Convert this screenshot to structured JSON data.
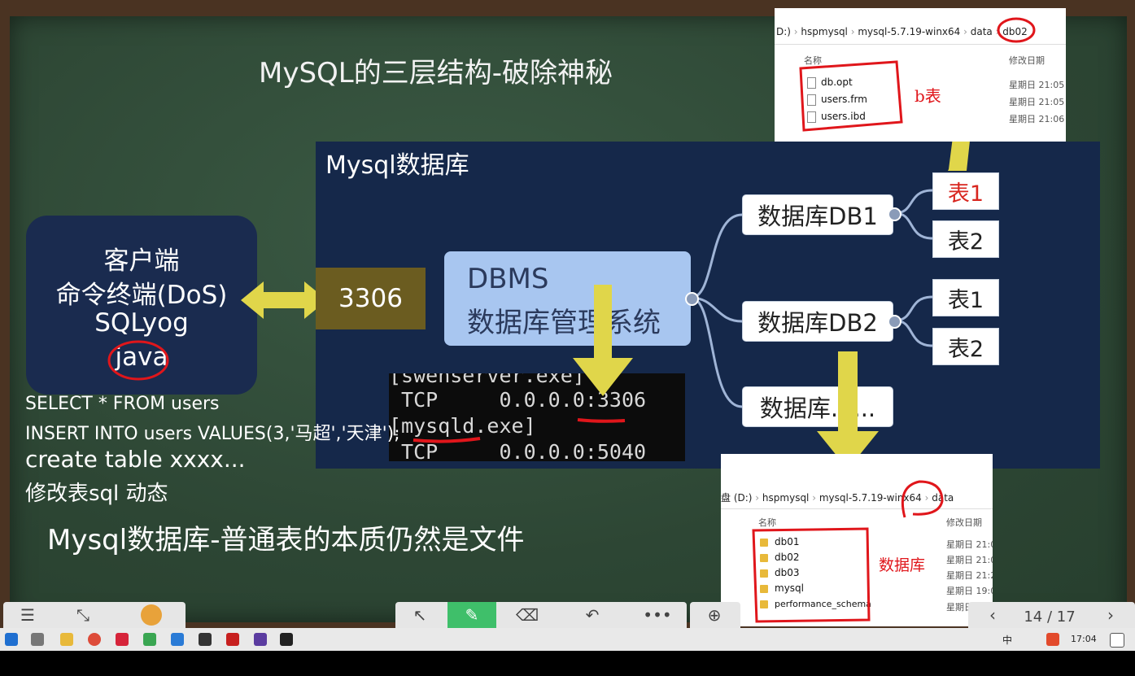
{
  "slide": {
    "title": "MySQL的三层结构-破除神秘",
    "db_panel_title": "Mysql数据库",
    "client": {
      "lines": [
        "客户端",
        "命令终端(DoS)",
        "SQLyog",
        "java"
      ]
    },
    "port": "3306",
    "dbms": {
      "line1": "DBMS",
      "line2": "数据库管理系统"
    },
    "databases": [
      {
        "label": "数据库DB1",
        "tables": [
          "表1",
          "表2"
        ]
      },
      {
        "label": "数据库DB2",
        "tables": [
          "表1",
          "表2"
        ]
      },
      {
        "label": "数据库......"
      }
    ],
    "cmd_lines": [
      "[swenserver.exe]",
      " TCP     0.0.0.0:3306",
      "[mysqld.exe]",
      " TCP     0.0.0.0:5040"
    ],
    "sql_lines": [
      "SELECT * FROM users",
      "INSERT INTO users VALUES(3,'马超','天津');",
      "create table xxxx...",
      "修改表sql 动态"
    ],
    "footer": "Mysql数据库-普通表的本质仍然是文件"
  },
  "explorer_top": {
    "breadcrumb": [
      "D:)",
      "hspmysql",
      "mysql-5.7.19-winx64",
      "data",
      "db02"
    ],
    "col_name": "名称",
    "col_date": "修改日期",
    "files": [
      {
        "name": "db.opt",
        "date": "星期日 21:05"
      },
      {
        "name": "users.frm",
        "date": "星期日 21:05"
      },
      {
        "name": "users.ibd",
        "date": "星期日 21:06"
      }
    ],
    "annotation": "b表"
  },
  "explorer_bottom": {
    "breadcrumb": [
      "盘 (D:)",
      "hspmysql",
      "mysql-5.7.19-winx64",
      "data"
    ],
    "col_name": "名称",
    "col_date": "修改日期",
    "folders": [
      {
        "name": "db01",
        "date": "星期日 21:0"
      },
      {
        "name": "db02",
        "date": "星期日 21:0"
      },
      {
        "name": "db03",
        "date": "星期日 21:2"
      },
      {
        "name": "mysql",
        "date": "星期日 19:0"
      },
      {
        "name": "performance_schema",
        "date": "星期日 19:0"
      }
    ],
    "annotation": "数据库"
  },
  "player": {
    "page": "14 / 17"
  },
  "taskbar": {
    "time": "17:04",
    "ime": "中"
  },
  "colors": {
    "board": "#2f4a36",
    "panel": "#15284a",
    "arrow": "#e0d64a",
    "red_mark": "#e0161b",
    "dbms": "#a8c6f0"
  },
  "icons": [
    "menu-icon",
    "collapse-icon",
    "avatar-icon",
    "pointer-icon",
    "pen-icon",
    "eraser-icon",
    "undo-icon",
    "more-icon",
    "touch-icon",
    "prev-icon",
    "next-icon",
    "windows-icon",
    "notification-icon"
  ]
}
